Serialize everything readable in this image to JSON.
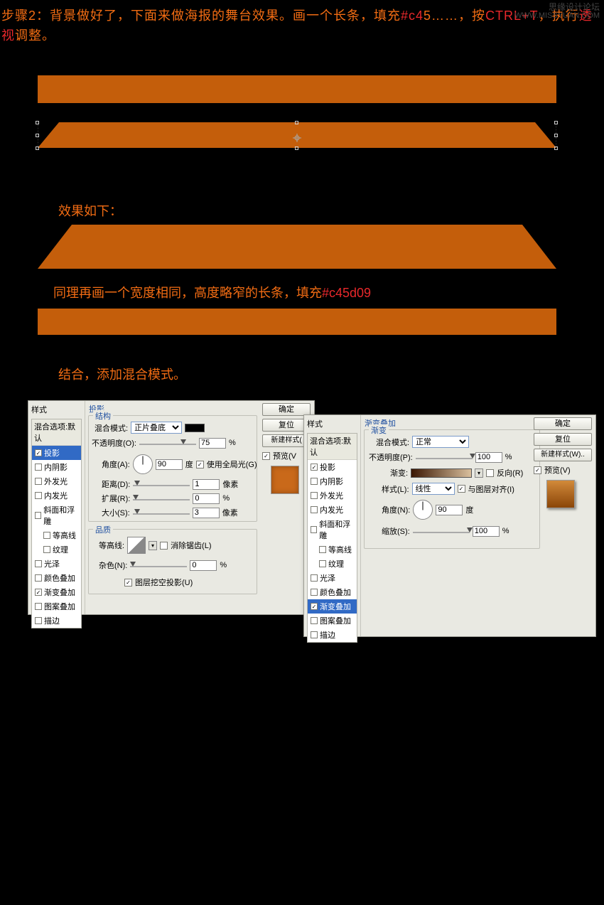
{
  "watermark": {
    "cn": "思缘设计论坛",
    "en": "WWW.MISSYUAN.COM"
  },
  "step": {
    "prefix": "步骤2：背景做好了，下面来做海报的舞台效果。画一个长条，填充",
    "hex1": "#c4",
    "after_hex1": "5……，按",
    "ctrl": "CTRL+T",
    "after_ctrl": "，执行",
    "persp": "透视",
    "suffix": "调整。"
  },
  "effect_label": "效果如下：",
  "line2": {
    "p1": "同理再画一个宽度相同，高度略窄的长条，填充",
    "hex": "#c45d09"
  },
  "line3": "结合，添加混合模式。",
  "dialog1": {
    "styles_header": "样式",
    "blend_opts": "混合选项:默认",
    "items": [
      {
        "label": "投影",
        "checked": true,
        "sel": true
      },
      {
        "label": "内阴影",
        "checked": false
      },
      {
        "label": "外发光",
        "checked": false
      },
      {
        "label": "内发光",
        "checked": false
      },
      {
        "label": "斜面和浮雕",
        "checked": false
      },
      {
        "label": "等高线",
        "checked": false,
        "indent": true
      },
      {
        "label": "纹理",
        "checked": false,
        "indent": true
      },
      {
        "label": "光泽",
        "checked": false
      },
      {
        "label": "颜色叠加",
        "checked": false
      },
      {
        "label": "渐变叠加",
        "checked": true
      },
      {
        "label": "图案叠加",
        "checked": false
      },
      {
        "label": "描边",
        "checked": false
      }
    ],
    "panel_title": "投影",
    "struct": "结构",
    "blend_mode_l": "混合模式:",
    "blend_mode_v": "正片叠底",
    "opacity_l": "不透明度(O):",
    "opacity_v": "75",
    "pct": "%",
    "angle_l": "角度(A):",
    "angle_v": "90",
    "deg": "度",
    "global": "使用全局光(G)",
    "dist_l": "距离(D):",
    "dist_v": "1",
    "px": "像素",
    "spread_l": "扩展(R):",
    "spread_v": "0",
    "size_l": "大小(S):",
    "size_v": "3",
    "quality": "品质",
    "contour_l": "等高线:",
    "antialias": "消除锯齿(L)",
    "noise_l": "杂色(N):",
    "noise_v": "0",
    "knockout": "图层挖空投影(U)",
    "btn_ok": "确定",
    "btn_cancel": "复位",
    "btn_new": "新建样式(",
    "preview": "预览(V"
  },
  "dialog2": {
    "styles_header": "样式",
    "blend_opts": "混合选项:默认",
    "items": [
      {
        "label": "投影",
        "checked": true
      },
      {
        "label": "内阴影",
        "checked": false
      },
      {
        "label": "外发光",
        "checked": false
      },
      {
        "label": "内发光",
        "checked": false
      },
      {
        "label": "斜面和浮雕",
        "checked": false
      },
      {
        "label": "等高线",
        "checked": false,
        "indent": true
      },
      {
        "label": "纹理",
        "checked": false,
        "indent": true
      },
      {
        "label": "光泽",
        "checked": false
      },
      {
        "label": "颜色叠加",
        "checked": false
      },
      {
        "label": "渐变叠加",
        "checked": true,
        "sel": true
      },
      {
        "label": "图案叠加",
        "checked": false
      },
      {
        "label": "描边",
        "checked": false
      }
    ],
    "panel_title": "渐变叠加",
    "grad_group": "渐变",
    "blend_mode_l": "混合模式:",
    "blend_mode_v": "正常",
    "opacity_l": "不透明度(P):",
    "opacity_v": "100",
    "pct": "%",
    "grad_l": "渐变:",
    "reverse": "反向(R)",
    "style_l": "样式(L):",
    "style_v": "线性",
    "align": "与图层对齐(I)",
    "angle_l": "角度(N):",
    "angle_v": "90",
    "deg": "度",
    "scale_l": "缩放(S):",
    "scale_v": "100",
    "hex_left": "#522704",
    "hex_right": "#c45d09",
    "btn_ok": "确定",
    "btn_cancel": "复位",
    "btn_new": "新建样式(W)..",
    "preview": "预览(V)"
  }
}
